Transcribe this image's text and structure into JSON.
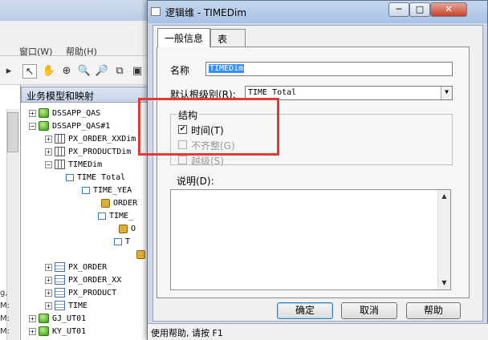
{
  "background_app": {
    "menus": [
      {
        "label": "窗口(W)"
      },
      {
        "label": "帮助(H)"
      }
    ],
    "panel_title": "业务模型和映射",
    "left_strip_texts": [
      "g,",
      "M:",
      "M:",
      "M:"
    ],
    "tree": [
      {
        "label": "DSSAPP_QAS",
        "icon": "database-icon",
        "expander": "+"
      },
      {
        "label": "DSSAPP_QAS#1",
        "icon": "database-icon",
        "expander": "−"
      },
      {
        "label": "PX_ORDER_XXDim",
        "icon": "dimension-icon",
        "expander": "+"
      },
      {
        "label": "PX_PRODUCTDim",
        "icon": "dimension-icon",
        "expander": "+"
      },
      {
        "label": "TIMEDim",
        "icon": "dimension-icon",
        "expander": "−"
      },
      {
        "label": "TIME Total",
        "icon": "level-icon",
        "expander": ""
      },
      {
        "label": "TIME_YEA",
        "icon": "level-icon",
        "expander": ""
      },
      {
        "label": "ORDER",
        "icon": "key-icon",
        "expander": ""
      },
      {
        "label": "TIME_",
        "icon": "level-icon",
        "expander": ""
      },
      {
        "label": "O",
        "icon": "key-icon",
        "expander": ""
      },
      {
        "label": "T",
        "icon": "level-icon",
        "expander": ""
      },
      {
        "label": "",
        "icon": "key-icon",
        "expander": ""
      },
      {
        "label": "PX_ORDER",
        "icon": "table-icon",
        "expander": "+"
      },
      {
        "label": "PX_ORDER_XX",
        "icon": "table-icon",
        "expander": "+"
      },
      {
        "label": "PX_PRODUCT",
        "icon": "table-icon",
        "expander": "+"
      },
      {
        "label": "TIME",
        "icon": "table-icon",
        "expander": "+"
      },
      {
        "label": "GJ_UT01",
        "icon": "database-icon",
        "expander": "+"
      },
      {
        "label": "KY_UT01",
        "icon": "database-icon",
        "expander": "+"
      }
    ]
  },
  "dialog": {
    "title": "逻辑维 - TIMEDim",
    "window_buttons": {
      "minimize": "─",
      "maximize": "□",
      "close": "✕"
    },
    "tabs": [
      {
        "label": "一般信息",
        "active": true
      },
      {
        "label": "表",
        "active": false
      }
    ],
    "name_label": "名称",
    "name_value": "TIMEDim",
    "default_level_label": "默认根级别(R):",
    "default_level_value": "TIME Total",
    "structure_label": "结构",
    "checkboxes": [
      {
        "label": "时间(T)",
        "checked": true,
        "enabled": true
      },
      {
        "label": "不齐整(G)",
        "checked": false,
        "enabled": false
      },
      {
        "label": "越级(S)",
        "checked": false,
        "enabled": false
      }
    ],
    "description_label": "说明(D):",
    "description_value": "",
    "buttons": {
      "ok": "确定",
      "cancel": "取消",
      "help": "帮助"
    }
  },
  "status_bar": "使用帮助, 请按 F1",
  "colors": {
    "highlight": "#e53935",
    "selection": "#3390ff"
  }
}
